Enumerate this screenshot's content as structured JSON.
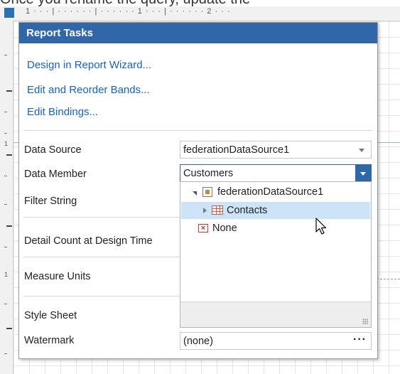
{
  "background": {
    "header_text": "Once you rename the query, update the",
    "ruler_marks": "1 · · · | · · · · · · | · · · · · · 1 · · · | · · · · · · 2 · · ·"
  },
  "panel": {
    "title": "Report Tasks",
    "links": [
      "Design in Report Wizard...",
      "Edit and Reorder Bands...",
      "Edit Bindings..."
    ],
    "properties": {
      "data_source": {
        "label": "Data Source",
        "value": "federationDataSource1"
      },
      "data_member": {
        "label": "Data Member",
        "value": "Customers"
      },
      "filter_string": {
        "label": "Filter String"
      },
      "detail_count": {
        "label": "Detail Count at Design Time"
      },
      "measure_units": {
        "label": "Measure Units"
      },
      "style_sheet": {
        "label": "Style Sheet"
      },
      "watermark": {
        "label": "Watermark",
        "value": "(none)",
        "button": "···"
      }
    }
  },
  "dropdown": {
    "tree": [
      {
        "label": "federationDataSource1",
        "expanded": true,
        "icon": "datasource-icon"
      },
      {
        "label": "Contacts",
        "expanded": false,
        "selected": true,
        "icon": "table-icon"
      },
      {
        "label": "None",
        "icon": "none-icon"
      }
    ]
  },
  "colors": {
    "accent": "#2f67a9",
    "link": "#1a62b4",
    "selection": "#cde3f7"
  }
}
